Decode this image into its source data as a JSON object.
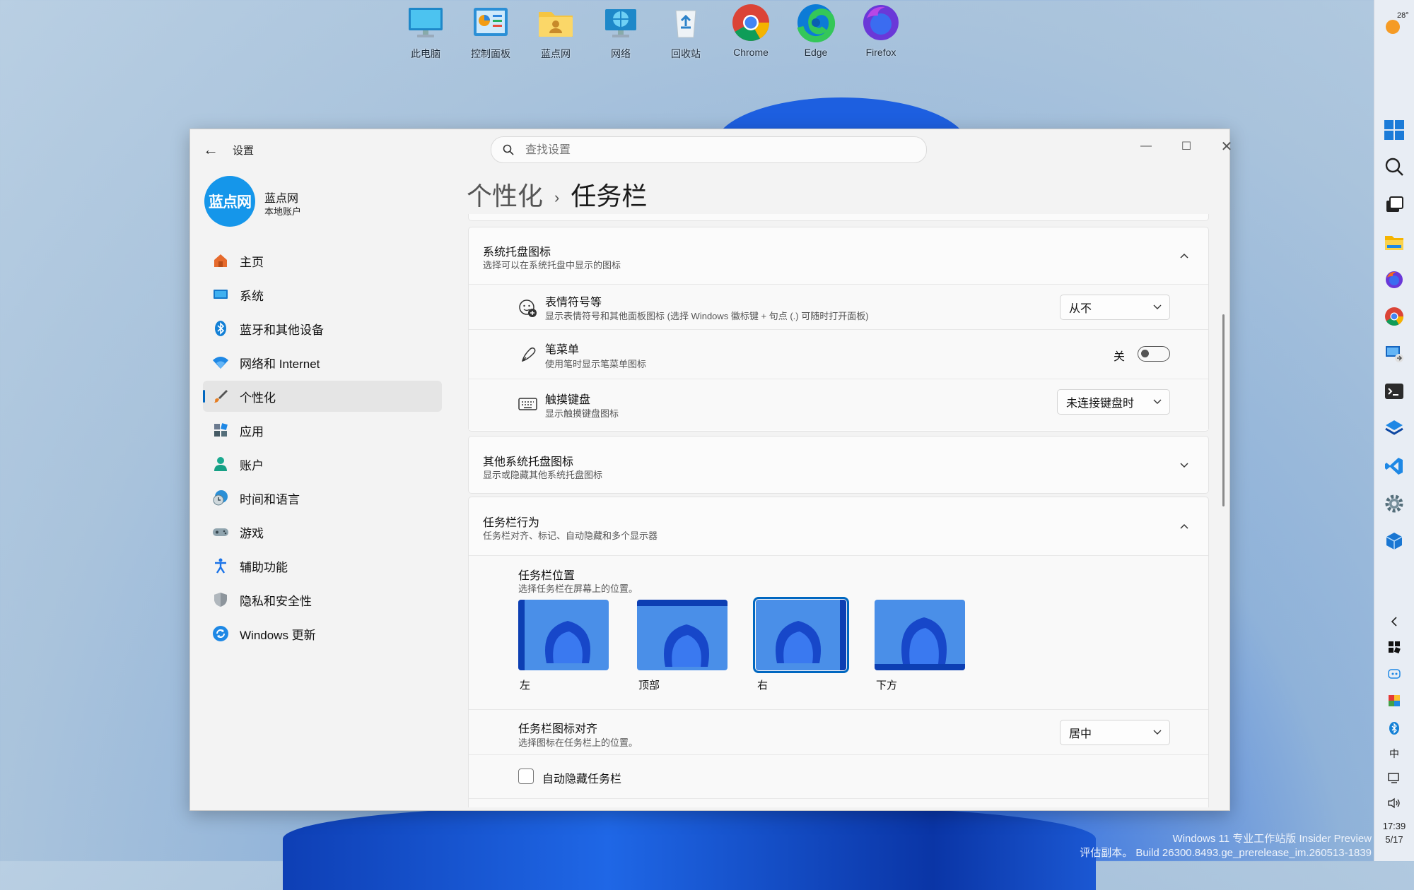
{
  "desktop": {
    "icons": [
      {
        "label": "此电脑",
        "icon": "computer-icon"
      },
      {
        "label": "控制面板",
        "icon": "control-panel-icon"
      },
      {
        "label": "蓝点网",
        "icon": "user-folder-icon"
      },
      {
        "label": "网络",
        "icon": "network-icon"
      },
      {
        "label": "回收站",
        "icon": "recycle-bin-icon"
      },
      {
        "label": "Chrome",
        "icon": "chrome-icon"
      },
      {
        "label": "Edge",
        "icon": "edge-icon"
      },
      {
        "label": "Firefox",
        "icon": "firefox-icon"
      }
    ],
    "watermark_line1": "Windows 11 专业工作站版 Insider Preview",
    "watermark_line2": "评估副本。 Build 26300.8493.ge_prerelease_im.260513-1839"
  },
  "taskbar": {
    "weather_temp": "28°",
    "ime": "中",
    "time": "17:39",
    "date": "5/17"
  },
  "window": {
    "app_title": "设置",
    "search_placeholder": "查找设置",
    "user": {
      "avatar_text": "蓝点网",
      "name": "蓝点网",
      "type": "本地账户"
    },
    "nav": [
      {
        "label": "主页",
        "icon": "home-icon"
      },
      {
        "label": "系统",
        "icon": "system-icon"
      },
      {
        "label": "蓝牙和其他设备",
        "icon": "bluetooth-icon"
      },
      {
        "label": "网络和 Internet",
        "icon": "wifi-icon"
      },
      {
        "label": "个性化",
        "icon": "brush-icon",
        "active": true
      },
      {
        "label": "应用",
        "icon": "apps-icon"
      },
      {
        "label": "账户",
        "icon": "account-icon"
      },
      {
        "label": "时间和语言",
        "icon": "time-language-icon"
      },
      {
        "label": "游戏",
        "icon": "gamepad-icon"
      },
      {
        "label": "辅助功能",
        "icon": "accessibility-icon"
      },
      {
        "label": "隐私和安全性",
        "icon": "shield-icon"
      },
      {
        "label": "Windows 更新",
        "icon": "update-icon"
      }
    ],
    "breadcrumb": {
      "parent": "个性化",
      "current": "任务栏"
    },
    "tray_icons": {
      "title": "系统托盘图标",
      "desc": "选择可以在系统托盘中显示的图标",
      "emoji": {
        "title": "表情符号等",
        "desc": "显示表情符号和其他面板图标 (选择 Windows 徽标键 + 句点 (.) 可随时打开面板)",
        "value": "从不"
      },
      "pen": {
        "title": "笔菜单",
        "desc": "使用笔时显示笔菜单图标",
        "state": "关",
        "on": false
      },
      "touch_kb": {
        "title": "触摸键盘",
        "desc": "显示触摸键盘图标",
        "value": "未连接键盘时"
      }
    },
    "other_tray": {
      "title": "其他系统托盘图标",
      "desc": "显示或隐藏其他系统托盘图标"
    },
    "behavior": {
      "title": "任务栏行为",
      "desc": "任务栏对齐、标记、自动隐藏和多个显示器",
      "position": {
        "title": "任务栏位置",
        "desc": "选择任务栏在屏幕上的位置。",
        "options": [
          "左",
          "顶部",
          "右",
          "下方"
        ],
        "selected": "右"
      },
      "alignment": {
        "title": "任务栏图标对齐",
        "desc": "选择图标在任务栏上的位置。",
        "value": "居中"
      },
      "autohide": {
        "label": "自动隐藏任务栏",
        "checked": false
      }
    }
  },
  "colors": {
    "accent": "#0067c0",
    "avatar": "#1596ea"
  }
}
